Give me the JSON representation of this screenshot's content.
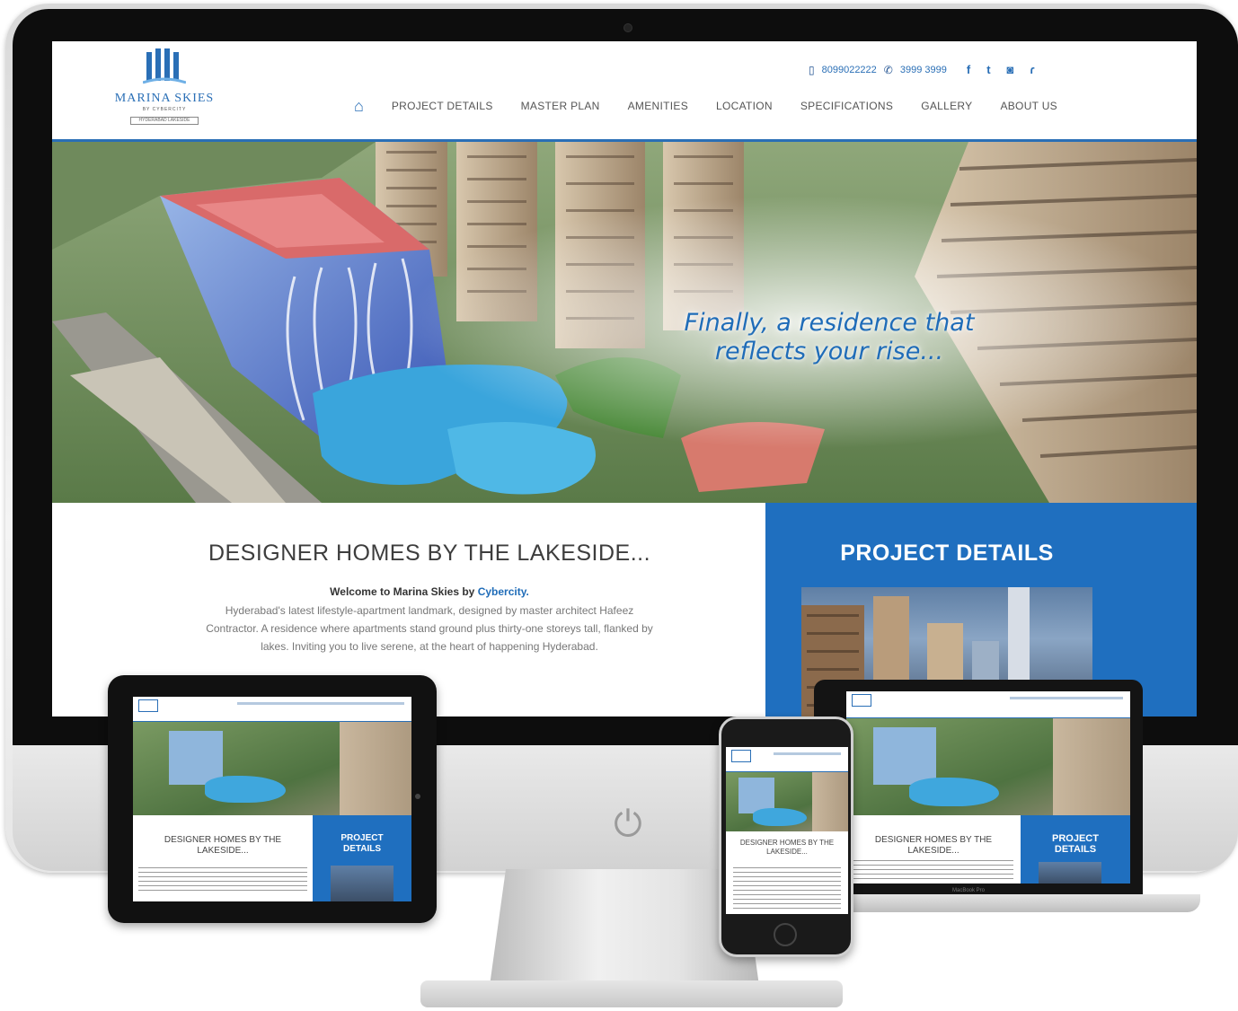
{
  "site": {
    "brand_name": "MARINA SKIES",
    "brand_sub": "BY CYBERCITY",
    "brand_tag": "HYDERABAD LAKESIDE",
    "phone_1": "8099022222",
    "phone_2": "3999 3999",
    "social": [
      {
        "icon": "facebook-icon",
        "glyph": "f"
      },
      {
        "icon": "twitter-icon",
        "glyph": "t"
      },
      {
        "icon": "instagram-icon",
        "glyph": "◙"
      },
      {
        "icon": "rss-icon",
        "glyph": "ɾ"
      }
    ],
    "nav": [
      "PROJECT DETAILS",
      "MASTER PLAN",
      "AMENITIES",
      "LOCATION",
      "SPECIFICATIONS",
      "GALLERY",
      "ABOUT US"
    ],
    "hero_line_1": "Finally, a residence that",
    "hero_line_2": "reflects your rise...",
    "heading": "DESIGNER HOMES BY THE LAKESIDE...",
    "welcome_prefix": "Welcome to Marina Skies by ",
    "welcome_brand": "Cybercity.",
    "body": "Hyderabad's latest lifestyle-apartment landmark, designed by master architect Hafeez Contractor. A residence where apartments stand ground plus thirty-one storeys tall, flanked by lakes. Inviting you to live serene, at the heart of happening Hyderabad.",
    "project_details": "PROJECT DETAILS",
    "corner_icons": "▢▢"
  },
  "mini": {
    "heading_short": "DESIGNER HOMES BY THE LAKESIDE...",
    "project_details": "PROJECT DETAILS",
    "laptop_label": "MacBook Pro"
  },
  "colors": {
    "brand_blue": "#1f6fbf",
    "nav_text": "#555555",
    "heading_text": "#3d3d3d"
  }
}
